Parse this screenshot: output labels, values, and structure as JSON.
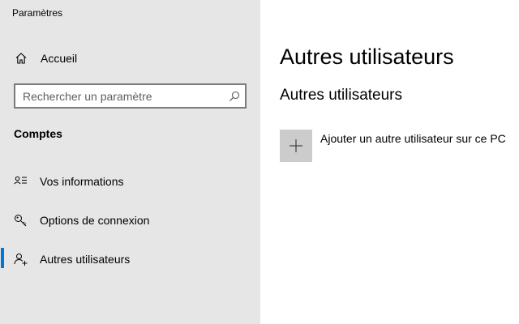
{
  "window": {
    "title": "Paramètres"
  },
  "sidebar": {
    "home": {
      "label": "Accueil",
      "icon": "home-icon"
    },
    "search": {
      "placeholder": "Rechercher un paramètre",
      "value": "",
      "icon": "search-icon"
    },
    "section_title": "Comptes",
    "items": [
      {
        "label": "Vos informations",
        "icon": "person-card-icon",
        "active": false
      },
      {
        "label": "Options de connexion",
        "icon": "key-icon",
        "active": false
      },
      {
        "label": "Autres utilisateurs",
        "icon": "add-person-icon",
        "active": true
      }
    ]
  },
  "main": {
    "page_title": "Autres utilisateurs",
    "section_title": "Autres utilisateurs",
    "add_user": {
      "label": "Ajouter un autre utilisateur sur ce PC",
      "icon": "plus-icon"
    }
  },
  "colors": {
    "sidebar_bg": "#e6e6e6",
    "accent": "#0078d7",
    "tile_bg": "#cccccc",
    "search_border": "#7a7a7a"
  }
}
